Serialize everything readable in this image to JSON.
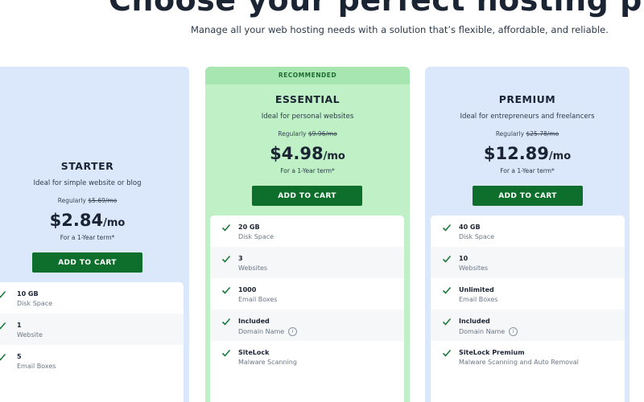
{
  "hero": {
    "title": "Choose your perfect hosting plan",
    "subtitle": "Manage all your web hosting needs with a solution that’s flexible, affordable, and reliable."
  },
  "colors": {
    "button": "#0e6e2b",
    "plan_blue": "#dbe8fc",
    "plan_green": "#bff0c6",
    "ribbon": "#a8e6b1",
    "check": "#1a7a3a"
  },
  "plans": [
    {
      "name": "STARTER",
      "description": "Ideal for simple website or blog",
      "regular_label": "Regularly",
      "regular_price": "$5.69/mo",
      "price": "$2.84",
      "per": "/mo",
      "term": "For a 1-Year term*",
      "button": "ADD TO CART",
      "features": [
        {
          "value": "10 GB",
          "label": "Disk Space",
          "icon": "check-icon"
        },
        {
          "value": "1",
          "label": "Website",
          "icon": "check-icon"
        },
        {
          "value": "5",
          "label": "Email Boxes",
          "icon": "check-icon"
        }
      ]
    },
    {
      "name": "ESSENTIAL",
      "badge": "RECOMMENDED",
      "description": "Ideal for personal websites",
      "regular_label": "Regularly",
      "regular_price": "$9.96/mo",
      "price": "$4.98",
      "per": "/mo",
      "term": "For a 1-Year term*",
      "button": "ADD TO CART",
      "features": [
        {
          "value": "20 GB",
          "label": "Disk Space",
          "icon": "check-icon"
        },
        {
          "value": "3",
          "label": "Websites",
          "icon": "check-icon"
        },
        {
          "value": "1000",
          "label": "Email Boxes",
          "icon": "check-icon"
        },
        {
          "value": "Included",
          "label": "Domain Name",
          "icon": "check-icon",
          "info": "i"
        },
        {
          "value": "SiteLock",
          "label": "Malware Scanning",
          "icon": "check-icon"
        }
      ]
    },
    {
      "name": "PREMIUM",
      "description": "Ideal for entrepreneurs and freelancers",
      "regular_label": "Regularly",
      "regular_price": "$25.78/mo",
      "price": "$12.89",
      "per": "/mo",
      "term": "For a 1-Year term*",
      "button": "ADD TO CART",
      "features": [
        {
          "value": "40 GB",
          "label": "Disk Space",
          "icon": "check-icon"
        },
        {
          "value": "10",
          "label": "Websites",
          "icon": "check-icon"
        },
        {
          "value": "Unlimited",
          "label": "Email Boxes",
          "icon": "check-icon"
        },
        {
          "value": "Included",
          "label": "Domain Name",
          "icon": "check-icon",
          "info": "i"
        },
        {
          "value": "SiteLock Premium",
          "label": "Malware Scanning and Auto Removal",
          "icon": "check-icon"
        }
      ]
    }
  ]
}
